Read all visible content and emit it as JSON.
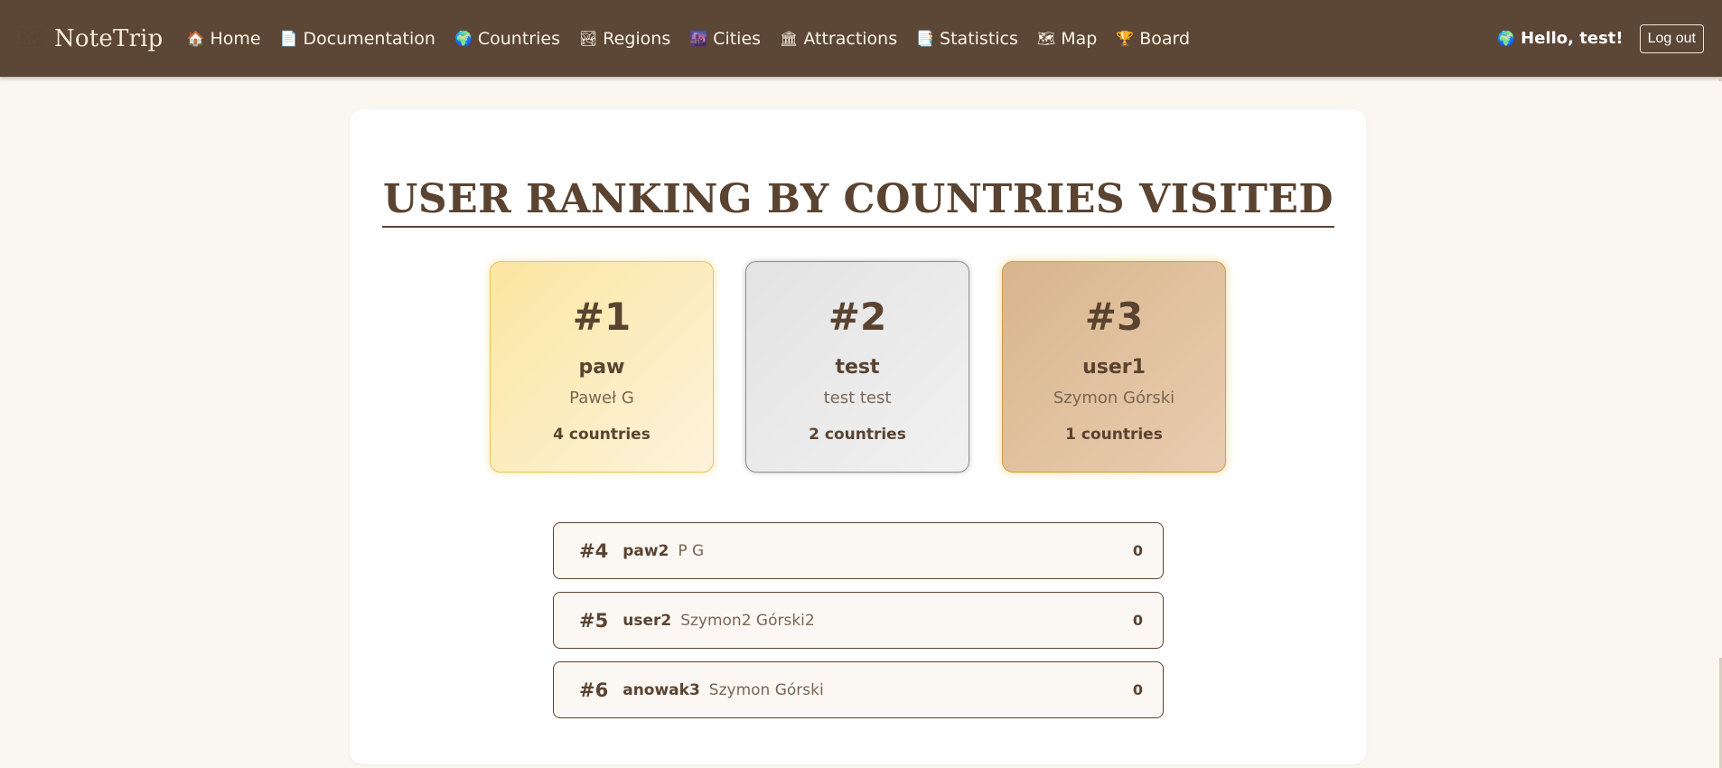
{
  "navbar": {
    "brand": {
      "icon": "🗺",
      "name": "NoteTrip"
    },
    "links": [
      {
        "icon": "🏠",
        "label": "Home"
      },
      {
        "icon": "📄",
        "label": "Documentation"
      },
      {
        "icon": "🌍",
        "label": "Countries"
      },
      {
        "icon": "🏞",
        "label": "Regions"
      },
      {
        "icon": "🌆",
        "label": "Cities"
      },
      {
        "icon": "🏛",
        "label": "Attractions"
      },
      {
        "icon": "📑",
        "label": "Statistics"
      },
      {
        "icon": "🗺",
        "label": "Map"
      },
      {
        "icon": "🏆",
        "label": "Board"
      }
    ],
    "greeting": {
      "icon": "🌍",
      "text": "Hello, test!"
    },
    "logout_label": "Log out"
  },
  "main": {
    "title": "USER RANKING BY COUNTRIES VISITED",
    "podium": [
      {
        "rank": "#1",
        "username": "paw",
        "full_name": "Paweł G",
        "count": "4 countries"
      },
      {
        "rank": "#2",
        "username": "test",
        "full_name": "test test",
        "count": "2 countries"
      },
      {
        "rank": "#3",
        "username": "user1",
        "full_name": "Szymon Górski",
        "count": "1 countries"
      }
    ],
    "list": [
      {
        "rank": "#4",
        "username": "paw2",
        "full_name": "P G",
        "count": "0"
      },
      {
        "rank": "#5",
        "username": "user2",
        "full_name": "Szymon2 Górski2",
        "count": "0"
      },
      {
        "rank": "#6",
        "username": "anowak3",
        "full_name": "Szymon Górski",
        "count": "0"
      }
    ]
  },
  "colors": {
    "navbar_bg": "#5c4636",
    "page_bg": "#faf7f1",
    "text_brown": "#5a4330",
    "gold": "#fbe6a0",
    "silver": "#e3e3e3",
    "bronze": "#d9b58d"
  }
}
